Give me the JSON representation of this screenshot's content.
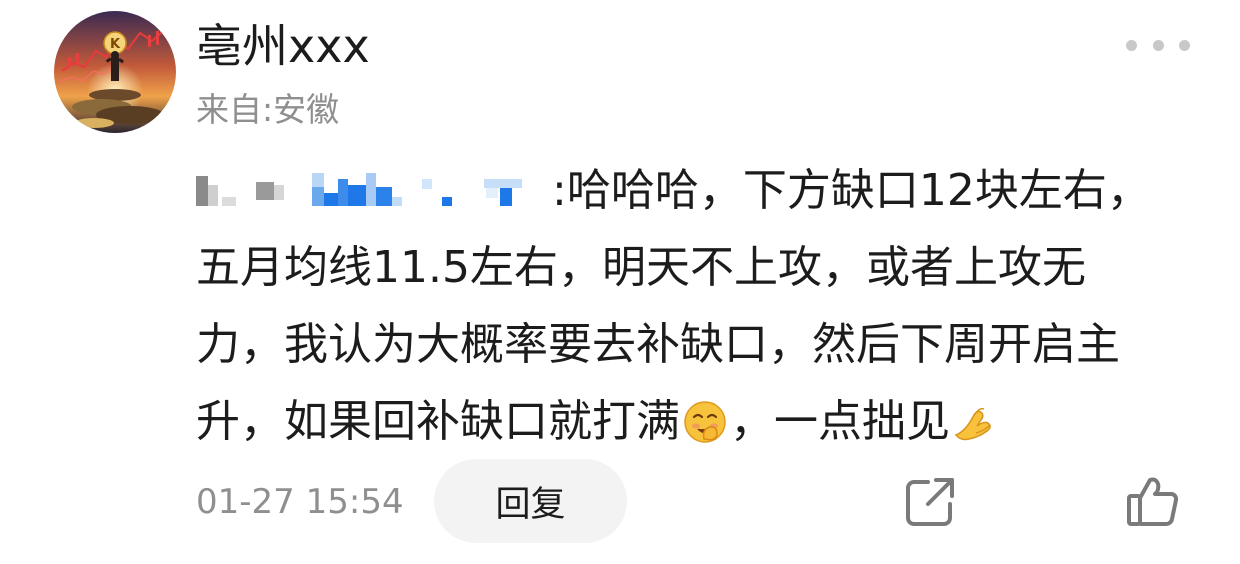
{
  "header": {
    "username": "亳州xxx",
    "location": "来自:安徽",
    "avatar_icon": "avatar-k-figure-icon",
    "more_icon": "more-dots-icon"
  },
  "comment": {
    "mention_icon": "pixelated-mention-icon",
    "mention_separator": ":",
    "lines": [
      "哈哈哈，下方缺口12块左右，",
      "五月均线11.5左右，明天不上攻，或者上攻无",
      "力，我认为大概率要去补缺口，然后下周开启主",
      "升，如果回补缺口就打满"
    ],
    "line4_middle": "，一点拙见",
    "emoji": [
      "smirk-face-emoji-icon",
      "pinched-hands-emoji-icon"
    ]
  },
  "footer": {
    "timestamp": "01-27 15:54",
    "reply_label": "回复",
    "share_icon": "share-icon",
    "like_icon": "thumbs-up-icon"
  },
  "colors": {
    "primary_text": "#1c1c1c",
    "secondary_text": "#8f8f8f",
    "reply_bg": "#f3f3f3",
    "icon_gray": "#7a7a7a",
    "mention_blue": "#1e78e8"
  }
}
